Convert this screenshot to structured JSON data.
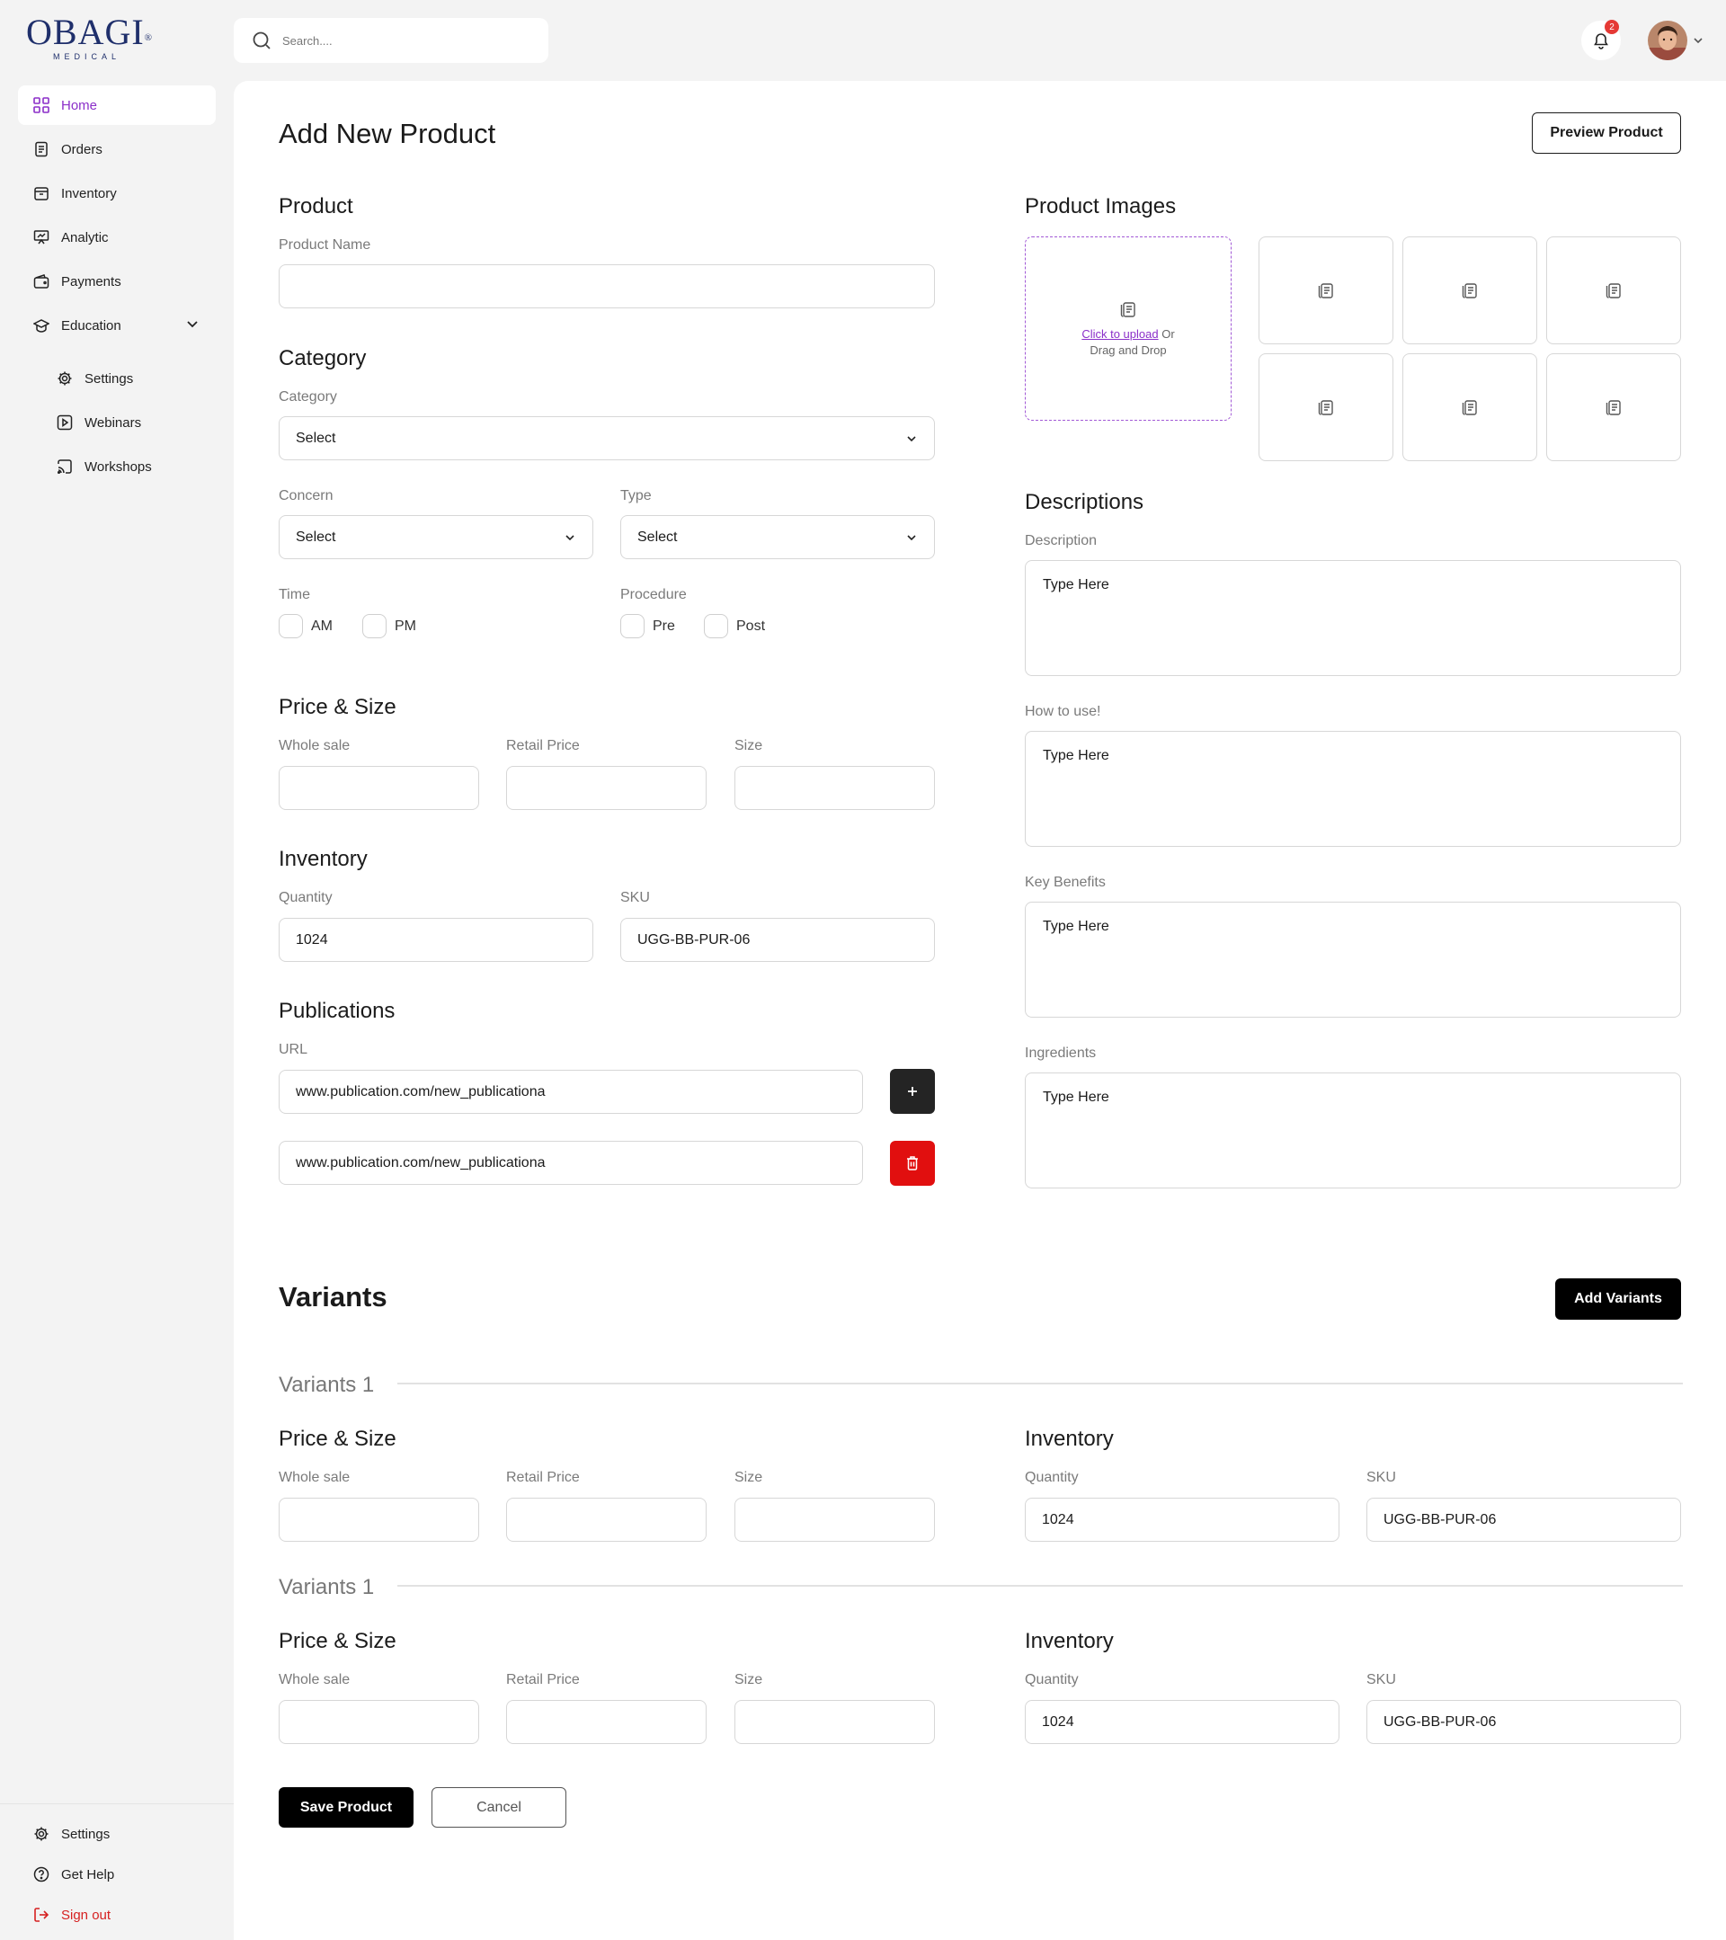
{
  "brand": {
    "name": "OBAGI",
    "registered": "®",
    "sub": "MEDICAL"
  },
  "sidebar": {
    "items": [
      {
        "label": "Home",
        "icon": "grid-icon",
        "active": true
      },
      {
        "label": "Orders",
        "icon": "receipt-icon"
      },
      {
        "label": "Inventory",
        "icon": "inventory-box-icon"
      },
      {
        "label": "Analytic",
        "icon": "analytic-board-icon"
      },
      {
        "label": "Payments",
        "icon": "wallet-icon"
      },
      {
        "label": "Education",
        "icon": "graduation-cap-icon",
        "expanded": true
      }
    ],
    "sub_items": [
      {
        "label": "Settings",
        "icon": "gear-icon"
      },
      {
        "label": "Webinars",
        "icon": "play-square-icon"
      },
      {
        "label": "Workshops",
        "icon": "cast-icon"
      }
    ],
    "bottom": [
      {
        "label": "Settings",
        "icon": "gear-icon"
      },
      {
        "label": "Get Help",
        "icon": "help-circle-icon"
      },
      {
        "label": "Sign out",
        "icon": "logout-icon"
      }
    ]
  },
  "topbar": {
    "search_placeholder": "Search....",
    "notifications_count": "2"
  },
  "page": {
    "title": "Add New Product",
    "preview_button": "Preview Product"
  },
  "product": {
    "heading": "Product",
    "name_label": "Product Name",
    "name_value": ""
  },
  "category": {
    "heading": "Category",
    "category_label": "Category",
    "category_value": "Select",
    "concern_label": "Concern",
    "concern_value": "Select",
    "type_label": "Type",
    "type_value": "Select",
    "time_label": "Time",
    "time_options": [
      "AM",
      "PM"
    ],
    "procedure_label": "Procedure",
    "procedure_options": [
      "Pre",
      "Post"
    ]
  },
  "price_size": {
    "heading": "Price & Size",
    "wholesale_label": "Whole sale",
    "retail_label": "Retail Price",
    "size_label": "Size"
  },
  "inventory": {
    "heading": "Inventory",
    "quantity_label": "Quantity",
    "quantity_value": "1024",
    "sku_label": "SKU",
    "sku_value": "UGG-BB-PUR-06"
  },
  "publications": {
    "heading": "Publications",
    "url_label": "URL",
    "urls": [
      "www.publication.com/new_publicationa",
      "www.publication.com/new_publicationa"
    ]
  },
  "images": {
    "heading": "Product Images",
    "upload_link": "Click to upload",
    "upload_or": " Or",
    "upload_drag": "Drag and Drop"
  },
  "descriptions": {
    "heading": "Descriptions",
    "fields": [
      {
        "label": "Description",
        "placeholder": "Type Here"
      },
      {
        "label": "How to use!",
        "placeholder": "Type Here"
      },
      {
        "label": "Key Benefits",
        "placeholder": "Type Here"
      },
      {
        "label": "Ingredients",
        "placeholder": "Type Here"
      }
    ]
  },
  "variants": {
    "heading": "Variants",
    "add_button": "Add Variants",
    "items": [
      {
        "title": "Variants 1",
        "price_heading": "Price & Size",
        "wholesale_label": "Whole sale",
        "retail_label": "Retail Price",
        "size_label": "Size",
        "inventory_heading": "Inventory",
        "quantity_label": "Quantity",
        "quantity_value": "1024",
        "sku_label": "SKU",
        "sku_value": "UGG-BB-PUR-06"
      },
      {
        "title": "Variants 1",
        "price_heading": "Price & Size",
        "wholesale_label": "Whole sale",
        "retail_label": "Retail Price",
        "size_label": "Size",
        "inventory_heading": "Inventory",
        "quantity_label": "Quantity",
        "quantity_value": "1024",
        "sku_label": "SKU",
        "sku_value": "UGG-BB-PUR-06"
      }
    ]
  },
  "actions": {
    "save": "Save Product",
    "cancel": "Cancel"
  },
  "colors": {
    "accent": "#8b2fc9",
    "danger": "#d62020",
    "background": "#f3f3f3",
    "brand": "#1f2f6b"
  }
}
